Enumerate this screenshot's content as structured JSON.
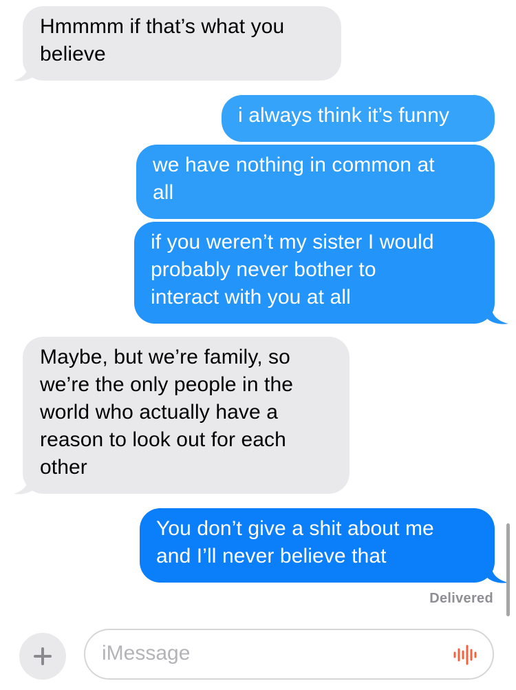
{
  "messages": [
    {
      "direction": "incoming",
      "text": "Hmmmm if that’s what you\nbelieve"
    },
    {
      "direction": "outgoing",
      "text": "i always think it’s funny"
    },
    {
      "direction": "outgoing",
      "text": "we have nothing in common at\nall"
    },
    {
      "direction": "outgoing",
      "text": "if you weren’t my sister I would\nprobably never bother to\ninteract with you at all"
    },
    {
      "direction": "incoming",
      "text": "Maybe, but we’re family, so\nwe’re the only people in the\nworld who actually have a\nreason to look out for each\nother"
    },
    {
      "direction": "outgoing",
      "text": "You don’t give a shit about me\nand I’ll never believe that"
    }
  ],
  "status": {
    "delivered": "Delivered"
  },
  "composer": {
    "placeholder": "iMessage",
    "add_icon": "plus-icon",
    "audio_icon": "waveform-icon"
  },
  "colors": {
    "incoming_bubble": "#e9e9eb",
    "outgoing_top": "#36a5fa",
    "outgoing_bottom": "#0b7ef9",
    "audio_icon": "#f2623f"
  }
}
